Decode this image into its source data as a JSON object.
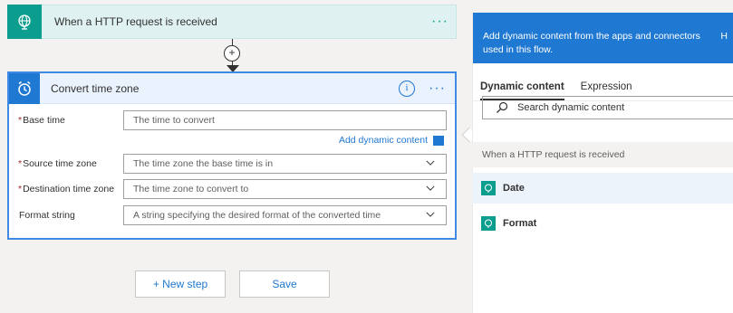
{
  "trigger": {
    "title": "When a HTTP request is received",
    "menu": "···"
  },
  "connector": {
    "plus": "+"
  },
  "action": {
    "title": "Convert time zone",
    "info": "i",
    "menu": "···",
    "fields": [
      {
        "label": "Base time",
        "required": "*",
        "placeholder": "The time to convert"
      },
      {
        "label": "Source time zone",
        "required": "*",
        "placeholder": "The time zone the base time is in"
      },
      {
        "label": "Destination time zone",
        "required": "*",
        "placeholder": "The time zone to convert to"
      },
      {
        "label": "Format string",
        "required": "",
        "placeholder": "A string specifying the desired format of the converted time"
      }
    ],
    "add_dynamic": "Add dynamic content"
  },
  "buttons": {
    "new_step": "+ New step",
    "save": "Save"
  },
  "panel": {
    "header": "Add dynamic content from the apps and connectors used in this flow.",
    "header_cut": "H",
    "tabs": [
      "Dynamic content",
      "Expression"
    ],
    "search_placeholder": "Search dynamic content",
    "section": "When a HTTP request is received",
    "items": [
      "Date",
      "Format"
    ]
  },
  "colors": {
    "teal": "#0b9e8f",
    "blue": "#1f78d1",
    "required": "#a4262c"
  }
}
